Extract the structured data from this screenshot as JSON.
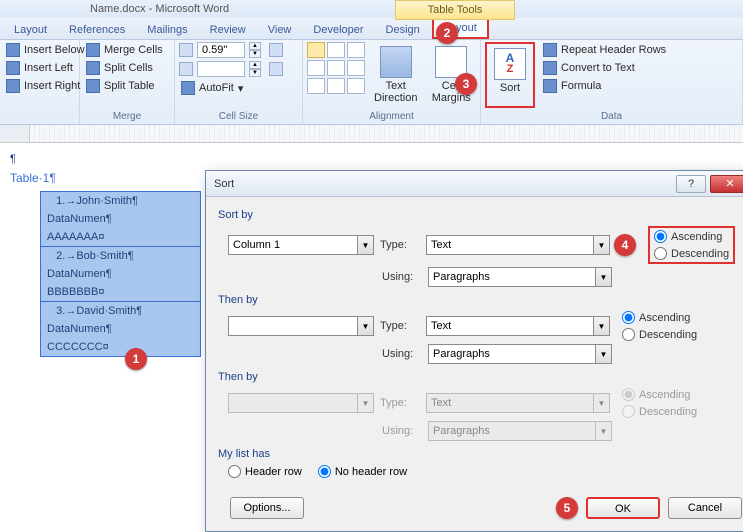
{
  "title": "Name.docx - Microsoft Word",
  "contextual_tab": "Table Tools",
  "tabs": [
    "Layout",
    "References",
    "Mailings",
    "Review",
    "View",
    "Developer",
    "Design",
    "Layout"
  ],
  "ribbon": {
    "rows": {
      "insert_below": "Insert Below",
      "insert_left": "Insert Left",
      "insert_right": "Insert Right",
      "merge_cells": "Merge Cells",
      "split_cells": "Split Cells",
      "split_table": "Split Table",
      "height_val": "0.59\"",
      "width_val": "",
      "autofit": "AutoFit",
      "text_direction": "Text Direction",
      "cell_margins": "Cell Margins",
      "sort": "Sort",
      "repeat_header": "Repeat Header Rows",
      "convert_text": "Convert to Text",
      "formula": "Formula"
    },
    "groups": {
      "merge": "Merge",
      "cellsize": "Cell Size",
      "alignment": "Alignment",
      "data": "Data"
    }
  },
  "doc": {
    "caption": "Table·1¶",
    "cells": [
      [
        "   1.→John·Smith¶",
        "DataNumen¶",
        "AAAAAAA¤"
      ],
      [
        "   2.→Bob·Smith¶",
        "DataNumen¶",
        "BBBBBBB¤"
      ],
      [
        "   3.→David·Smith¶",
        "DataNumen¶",
        "CCCCCCC¤"
      ]
    ]
  },
  "dialog": {
    "title": "Sort",
    "sortby_label": "Sort by",
    "thenby_label": "Then by",
    "thenby2_label": "Then by",
    "type_label": "Type:",
    "using_label": "Using:",
    "sortby_field": "Column 1",
    "type_val": "Text",
    "using_val": "Paragraphs",
    "ascending": "Ascending",
    "descending": "Descending",
    "mylist": "My list has",
    "header_row": "Header row",
    "no_header_row": "No header row",
    "options": "Options...",
    "ok": "OK",
    "cancel": "Cancel"
  }
}
